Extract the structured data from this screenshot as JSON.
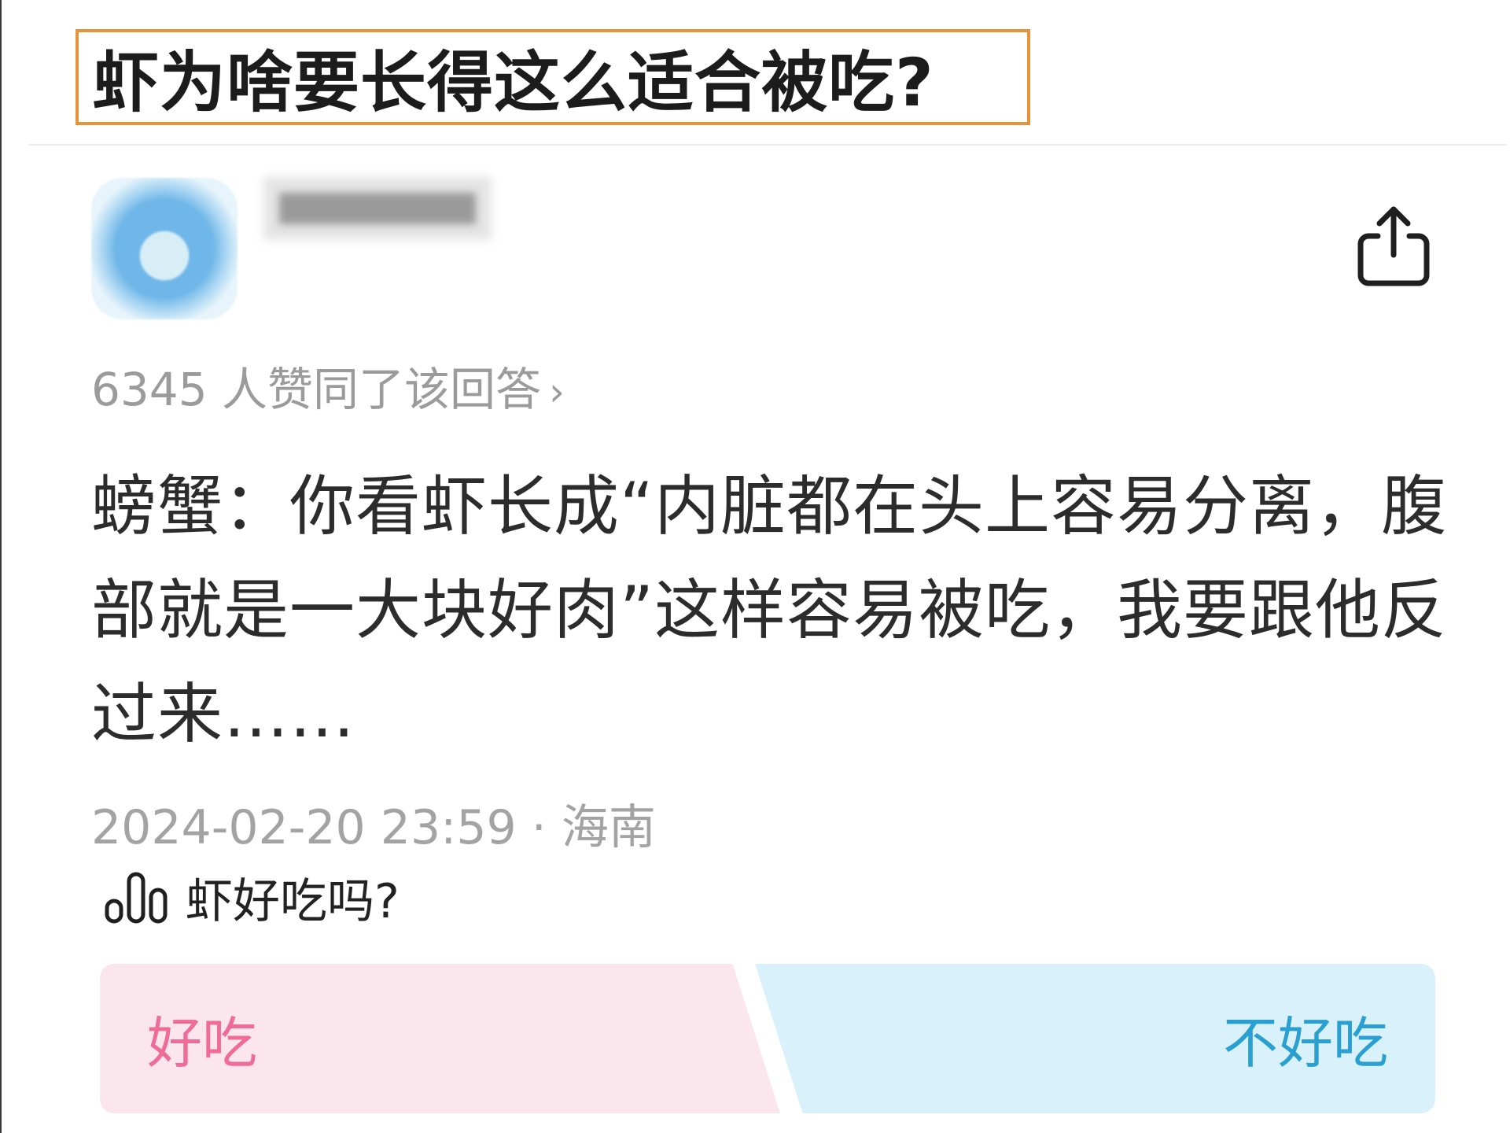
{
  "question": {
    "title": "虾为啥要长得这么适合被吃?"
  },
  "answer": {
    "likes_text": "6345 人赞同了该回答",
    "likes_chevron": "›",
    "content": "螃蟹：你看虾长成“内脏都在头上容易分离，腹部就是一大块好肉”这样容易被吃，我要跟他反过来……",
    "meta": "2024-02-20 23:59 · 海南"
  },
  "poll": {
    "question": "虾好吃吗?",
    "options": [
      "好吃",
      "不好吃"
    ]
  },
  "colors": {
    "title_border": "#e8923a",
    "option_yes_bg": "#fbe6ee",
    "option_yes_text": "#ee6c97",
    "option_no_bg": "#d9f1fb",
    "option_no_text": "#2a9fd2"
  },
  "icons": {
    "share": "share-icon",
    "poll": "poll-bars-icon"
  }
}
